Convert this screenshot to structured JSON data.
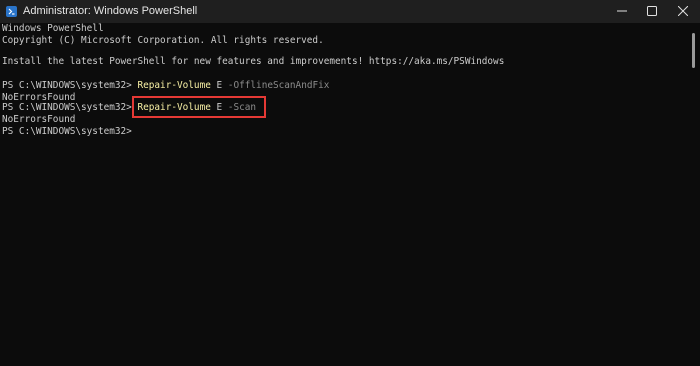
{
  "window": {
    "title": "Administrator: Windows PowerShell"
  },
  "icons": {
    "app": "powershell-icon",
    "minimize": "minimize-icon",
    "maximize": "maximize-icon",
    "close": "close-icon"
  },
  "console": {
    "header1": "Windows PowerShell",
    "header2": "Copyright (C) Microsoft Corporation. All rights reserved.",
    "install_msg": "Install the latest PowerShell for new features and improvements! https://aka.ms/PSWindows",
    "prompt": "PS C:\\WINDOWS\\system32>",
    "cmd1": {
      "cmdlet": "Repair-Volume",
      "arg": "E",
      "param": "-OfflineScanAndFix"
    },
    "out1": "NoErrorsFound",
    "cmd2": {
      "cmdlet": "Repair-Volume",
      "arg": "E",
      "param": "-Scan"
    },
    "out2": "NoErrorsFound"
  },
  "colors": {
    "background": "#0c0c0c",
    "text": "#cccccc",
    "cmdlet": "#f9f1a5",
    "parameter": "#8c8c8c",
    "highlight": "#e53935"
  }
}
